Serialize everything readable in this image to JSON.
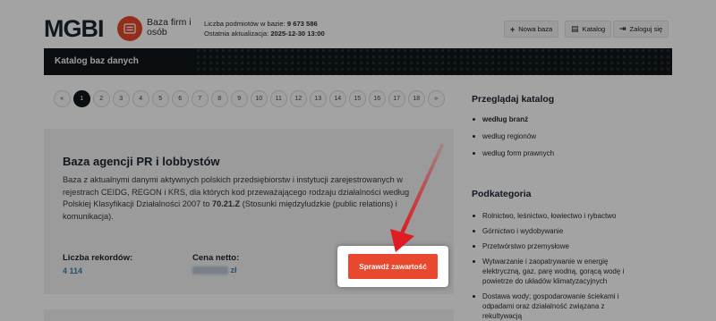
{
  "header": {
    "logo": "MGBI",
    "logo_sub": "Baza firm i osób",
    "stats_count_label": "Liczba podmiotów w bazie:",
    "stats_count": "9 673 586",
    "stats_update_label": "Ostatnia aktualizacja:",
    "stats_update": "2025-12-30 13:00",
    "buttons": {
      "new_base": "Nowa baza",
      "catalog": "Katalog",
      "login": "Zaloguj się"
    }
  },
  "darkbar": {
    "title": "Katalog baz danych"
  },
  "pagination": {
    "prev": "«",
    "next": "»",
    "pages": [
      "1",
      "2",
      "3",
      "4",
      "5",
      "6",
      "7",
      "8",
      "9",
      "10",
      "11",
      "12",
      "13",
      "14",
      "15",
      "16",
      "17",
      "18"
    ],
    "current": "1"
  },
  "card": {
    "title": "Baza agencji PR i lobbystów",
    "desc_before": "Baza z aktualnymi danymi aktywnych polskich przedsiębiorstw i instytucji zarejestrowanych w rejestrach CEIDG, REGON i KRS, dla których kod przeważającego rodzaju działalności według Polskiej Klasyfikacji Działalności 2007 to ",
    "desc_code": "70.21.Z",
    "desc_after": " (Stosunki międzyludzkie (public relations) i komunikacja).",
    "records_label": "Liczba rekordów:",
    "records_value": "4 114",
    "price_label": "Cena netto:",
    "price_currency": "zł",
    "cta": "Sprawdź zawartość"
  },
  "sidebar": {
    "browse_title": "Przeglądaj katalog",
    "browse_items": [
      "według branż",
      "według regionów",
      "według form prawnych"
    ],
    "sub_title": "Podkategoria",
    "sub_items": [
      "Rolnictwo, leśnictwo, łowiectwo i rybactwo",
      "Górnictwo i wydobywanie",
      "Przetwórstwo przemysłowe",
      "Wytwarzanie i zaopatrywanie w energię elektryczną, gaz, parę wodną, gorącą wodę i powietrze do układów klimatyzacyjnych",
      "Dostawa wody; gospodarowanie ściekami i odpadami oraz działalność związana z rekultywacją"
    ]
  },
  "colors": {
    "accent": "#e8482d",
    "dark": "#121619",
    "link": "#3b7fb3"
  }
}
